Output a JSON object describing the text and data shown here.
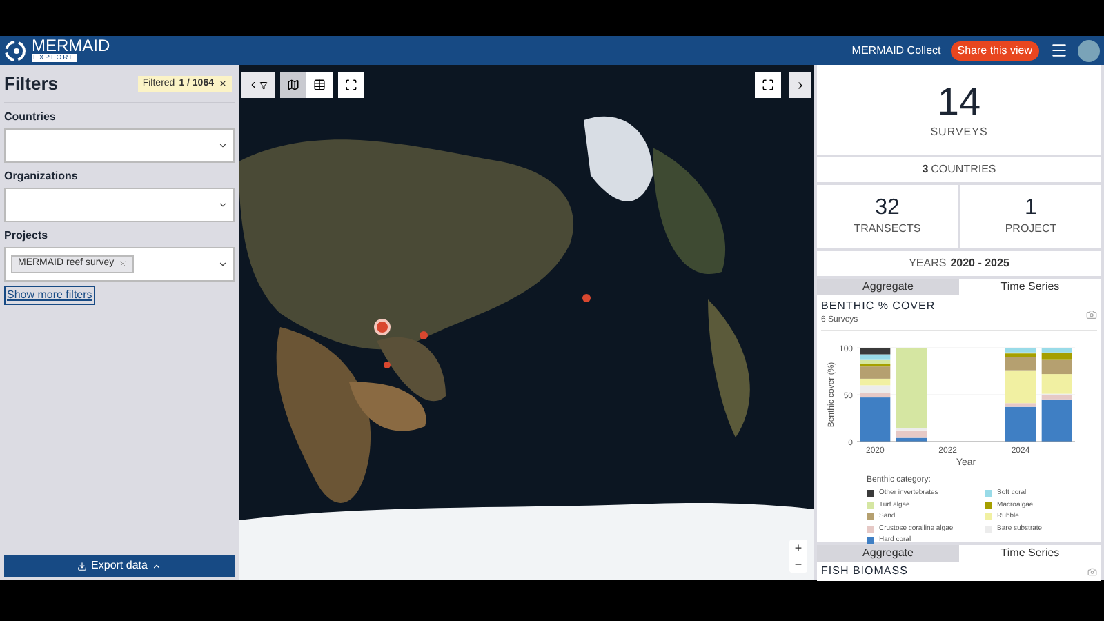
{
  "header": {
    "logo_title": "MERMAID",
    "logo_subtitle": "EXPLORE",
    "collect_link": "MERMAID Collect",
    "share_button": "Share this view"
  },
  "filters": {
    "title": "Filters",
    "badge": {
      "label": "Filtered",
      "count": "1 / 1064"
    },
    "fields": [
      {
        "label": "Countries"
      },
      {
        "label": "Organizations"
      },
      {
        "label": "Projects",
        "chips": [
          "MERMAID reef survey"
        ]
      }
    ],
    "show_more": "Show more filters",
    "export_button": "Export data"
  },
  "map": {
    "zoom_controls": [
      "+",
      "−"
    ]
  },
  "summary": {
    "surveys": {
      "value": "14",
      "label": "SURVEYS"
    },
    "countries": {
      "value": "3",
      "label": "COUNTRIES"
    },
    "transects": {
      "value": "32",
      "label": "TRANSECTS"
    },
    "projects": {
      "value": "1",
      "label": "PROJECT"
    },
    "years": {
      "label": "YEARS",
      "value": "2020 - 2025"
    }
  },
  "benthic": {
    "tabs": [
      {
        "label": "Aggregate",
        "selected": false
      },
      {
        "label": "Time Series",
        "selected": true
      }
    ],
    "title": "BENTHIC % COVER",
    "subtitle": "6 Surveys",
    "legend_title": "Benthic category:",
    "chart_data": {
      "type": "bar",
      "stacked": true,
      "xlabel": "Year",
      "ylabel": "Benthic cover (%)",
      "x": [
        2020,
        2021,
        2024,
        2025
      ],
      "xlim": [
        2019.5,
        2025.5
      ],
      "xticks": [
        2020,
        2022,
        2024
      ],
      "yticks": [
        0,
        50,
        100
      ],
      "ylim": [
        0,
        100
      ],
      "series": [
        {
          "name": "Hard coral",
          "color": "#3f7fc4",
          "values": [
            47,
            4,
            37,
            45
          ]
        },
        {
          "name": "Crustose coralline algae",
          "color": "#e6c9c6",
          "values": [
            5,
            8,
            4,
            5
          ]
        },
        {
          "name": "Bare substrate",
          "color": "#ececec",
          "values": [
            8,
            2,
            0,
            1
          ]
        },
        {
          "name": "Rubble",
          "color": "#f1f0a2",
          "values": [
            7,
            0,
            35,
            21
          ]
        },
        {
          "name": "Sand",
          "color": "#b5a070",
          "values": [
            13,
            0,
            14,
            15
          ]
        },
        {
          "name": "Macroalgae",
          "color": "#a59f00",
          "values": [
            3,
            0,
            4,
            8
          ]
        },
        {
          "name": "Turf algae",
          "color": "#d5e6a2",
          "values": [
            4,
            86,
            1,
            0
          ]
        },
        {
          "name": "Soft coral",
          "color": "#99dbe8",
          "values": [
            6,
            0,
            5,
            5
          ]
        },
        {
          "name": "Other invertebrates",
          "color": "#3a3a3a",
          "values": [
            7,
            0,
            0,
            0
          ]
        }
      ]
    }
  },
  "fish": {
    "tabs": [
      {
        "label": "Aggregate",
        "selected": false
      },
      {
        "label": "Time Series",
        "selected": true
      }
    ],
    "title": "FISH BIOMASS"
  }
}
